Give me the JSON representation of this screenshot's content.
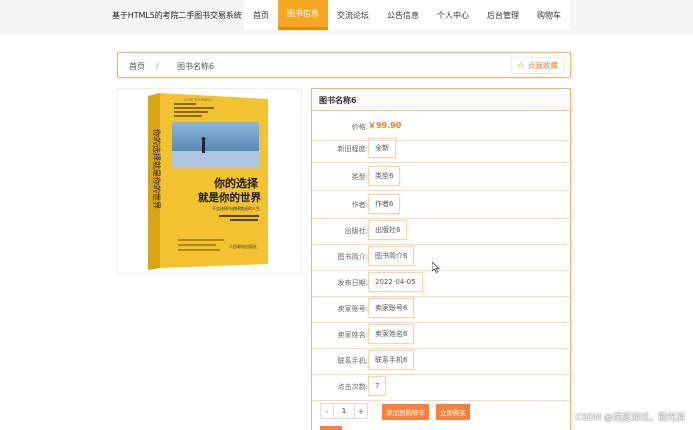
{
  "site": {
    "title": "基于HTML5的考院二手图书交易系统"
  },
  "nav": {
    "items": [
      "首页",
      "图书信息",
      "交流论坛",
      "公告信息",
      "个人中心",
      "后台管理",
      "购物车"
    ],
    "active_index": 1
  },
  "breadcrumb": {
    "home": "首页",
    "separator": "/",
    "current": "图书名称6",
    "favorite_label": "点我收藏"
  },
  "cover": {
    "tag_text": "LOVE YOURSELF",
    "title_line1": "你的选择",
    "title_line2": "就是你的世界",
    "subtitle": "不会选择与避择焦虑的人生",
    "spine_title": "你的选择就是你的世界",
    "publisher": "人民邮电出版社"
  },
  "detail": {
    "title": "图书名称6",
    "price_label": "价格:",
    "price_value": "￥99.90",
    "fields": [
      {
        "label": "新旧程度:",
        "value": "全新"
      },
      {
        "label": "类型:",
        "value": "类型6"
      },
      {
        "label": "作者:",
        "value": "作者6"
      },
      {
        "label": "出版社:",
        "value": "出版社6"
      },
      {
        "label": "图书简介:",
        "value": "图书简介6"
      },
      {
        "label": "发布日期:",
        "value": "2022-04-05"
      },
      {
        "label": "卖家账号:",
        "value": "卖家账号6"
      },
      {
        "label": "卖家姓名:",
        "value": "卖家姓名6"
      },
      {
        "label": "联系手机:",
        "value": "联系手机6"
      },
      {
        "label": "点击次数:",
        "value": "7"
      }
    ],
    "quantity": "1",
    "minus": "-",
    "plus": "+",
    "add_to_cart": "添加到购物车",
    "buy_now": "立即购买"
  },
  "watermark": "CSDN @浅夏淡过，微光凉",
  "colors": {
    "accent": "#f5a623",
    "button": "#f7813a",
    "price": "#f07b2b",
    "border": "#f6b27a"
  }
}
